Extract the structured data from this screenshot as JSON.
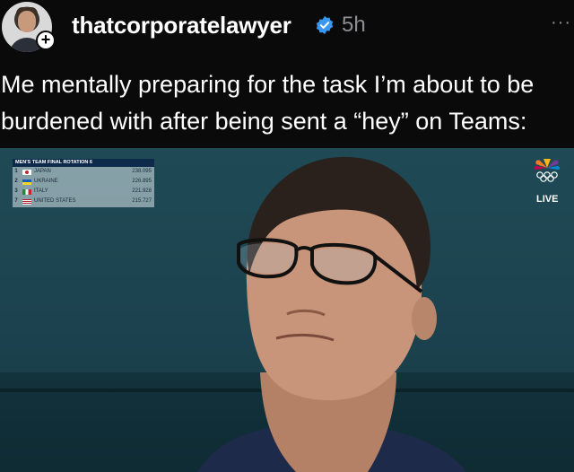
{
  "post": {
    "username": "thatcorporatelawyer",
    "time": "5h",
    "more": "···",
    "follow_badge": "+",
    "caption_line1": "Me mentally preparing for the task I’m about to be",
    "caption_line2": "burdened with after being sent a “hey” on Teams:"
  },
  "media": {
    "scoreboard": {
      "title": "MEN'S TEAM FINAL   ROTATION 6",
      "rows": [
        {
          "rank": "1",
          "team": "JAPAN",
          "score": "238.095",
          "flag": "japan-flag-icon"
        },
        {
          "rank": "2",
          "team": "UKRAINE",
          "score": "226.895",
          "flag": "ukraine-flag-icon"
        },
        {
          "rank": "3",
          "team": "ITALY",
          "score": "221.928",
          "flag": "italy-flag-icon"
        },
        {
          "rank": "7",
          "team": "UNITED STATES",
          "score": "215.727",
          "flag": "usa-flag-icon"
        }
      ]
    },
    "live_label": "LIVE",
    "network_logo": "nbc-olympics-icon"
  },
  "colors": {
    "background": "#0a0a0a",
    "text": "#ffffff",
    "secondary_text": "#8e8e93",
    "verified": "#3897f0"
  }
}
